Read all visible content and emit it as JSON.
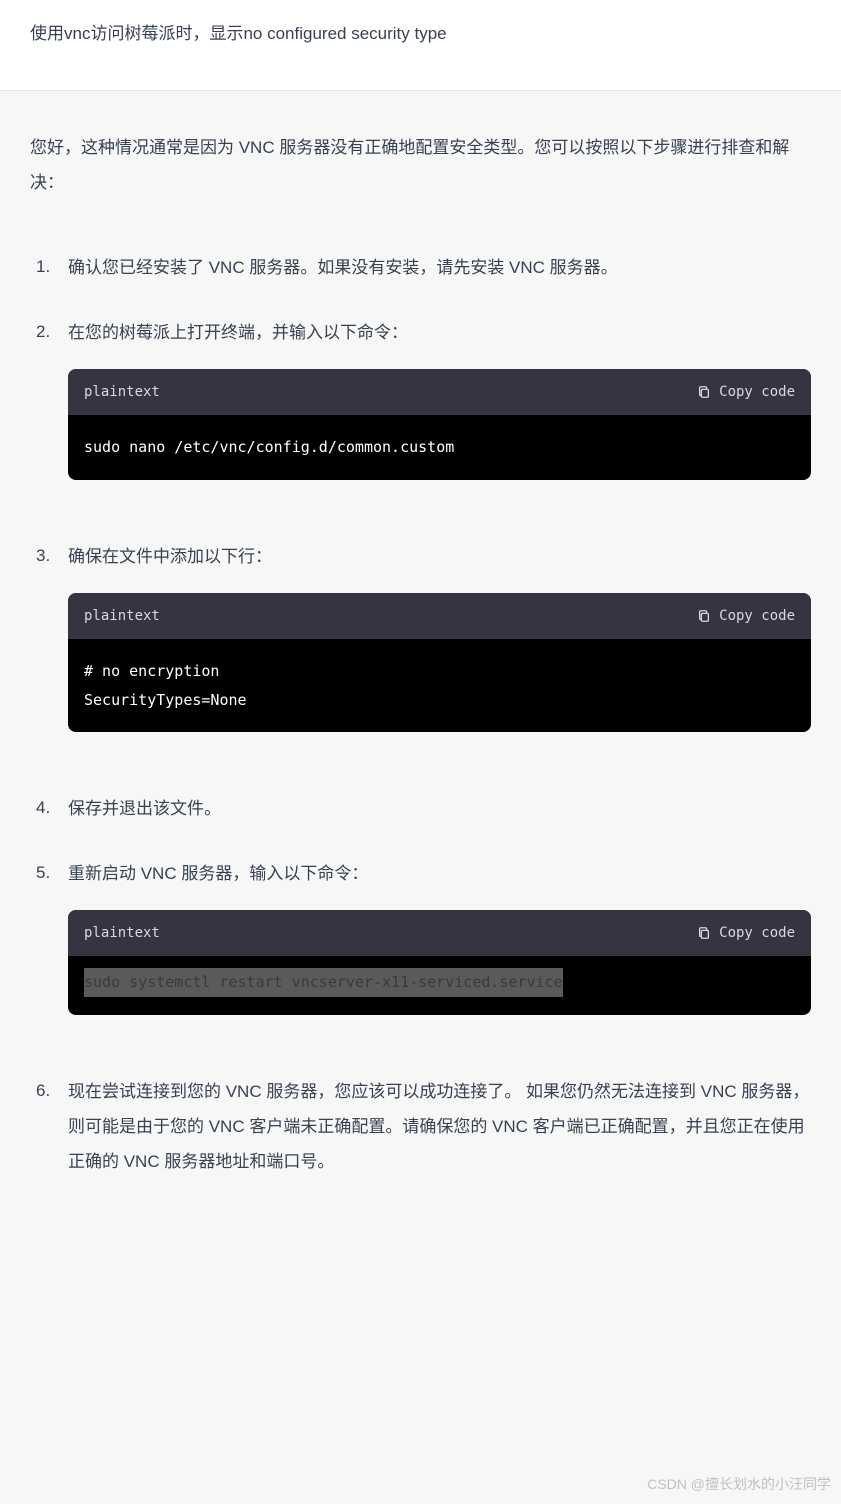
{
  "question": "使用vnc访问树莓派时，显示no configured security type",
  "intro": "您好，这种情况通常是因为 VNC 服务器没有正确地配置安全类型。您可以按照以下步骤进行排查和解决：",
  "steps": [
    {
      "text": "确认您已经安装了 VNC 服务器。如果没有安装，请先安装 VNC 服务器。"
    },
    {
      "text": "在您的树莓派上打开终端，并输入以下命令：",
      "code": {
        "lang": "plaintext",
        "copy": "Copy code",
        "body": "sudo nano /etc/vnc/config.d/common.custom"
      }
    },
    {
      "text": "确保在文件中添加以下行：",
      "code": {
        "lang": "plaintext",
        "copy": "Copy code",
        "body": "# no encryption\nSecurityTypes=None"
      }
    },
    {
      "text": "保存并退出该文件。"
    },
    {
      "text": "重新启动 VNC 服务器，输入以下命令：",
      "code": {
        "lang": "plaintext",
        "copy": "Copy code",
        "body": "sudo systemctl restart vncserver-x11-serviced.service",
        "highlighted": true
      }
    },
    {
      "text": "现在尝试连接到您的 VNC 服务器，您应该可以成功连接了。\n如果您仍然无法连接到 VNC 服务器，则可能是由于您的 VNC 客户端未正确配置。请确保您的 VNC 客户端已正确配置，并且您正在使用正确的 VNC 服务器地址和端口号。"
    }
  ],
  "watermark": "CSDN @擅长划水的小汪同学"
}
